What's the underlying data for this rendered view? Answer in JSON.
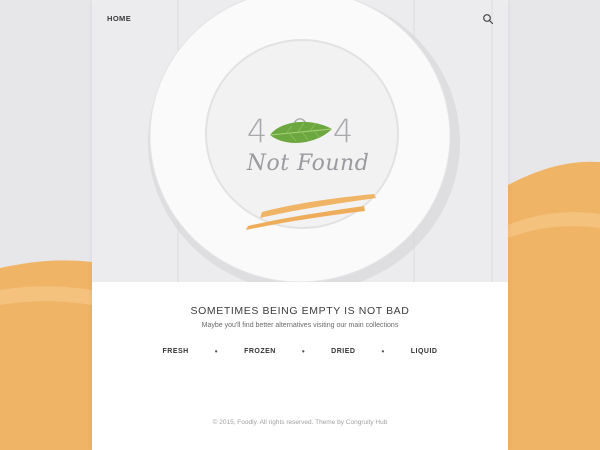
{
  "nav": {
    "home_label": "HOME"
  },
  "error": {
    "digits": [
      "4",
      "0",
      "4"
    ],
    "script_text": "Not Found"
  },
  "content": {
    "headline": "SOMETIMES BEING EMPTY IS NOT BAD",
    "subline": "Maybe you'll find better alternatives visiting our main collections",
    "collections": [
      "FRESH",
      "FROZEN",
      "DRIED",
      "LIQUID"
    ],
    "separator": "•"
  },
  "footer": {
    "text": "© 2015, Foodly. All rights reserved. Theme by Congruity Hub"
  },
  "colors": {
    "accent": "#f0b466",
    "background": "#e7e7ea",
    "card": "#ffffff",
    "leaf": "#6da73f"
  },
  "icons": {
    "search": "search-icon",
    "leaf": "mint-leaf-icon",
    "plate": "plate-illustration"
  }
}
